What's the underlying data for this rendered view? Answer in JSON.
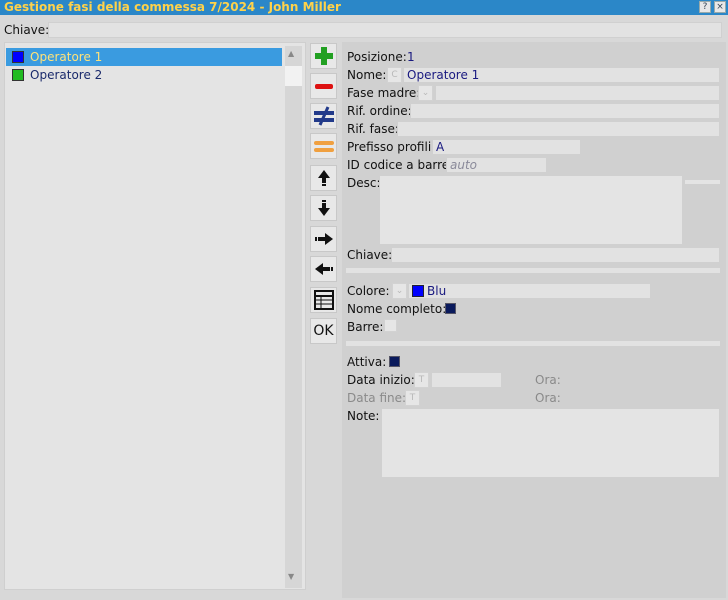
{
  "window": {
    "title": "Gestione fasi della commessa 7/2024 - John Miller",
    "btn_help": "?",
    "btn_close": "×"
  },
  "search": {
    "label": "Chiave:",
    "value": ""
  },
  "operators": [
    {
      "label": "Operatore 1",
      "color": "#0000ff"
    },
    {
      "label": "Operatore 2",
      "color": "#22bb22"
    }
  ],
  "toolbar": {
    "ok_label": "OK"
  },
  "form": {
    "posizione_label": "Posizione:",
    "posizione_value": "1",
    "nome_label": "Nome:",
    "nome_prefix": "C",
    "nome_value": "Operatore 1",
    "fase_madre_label": "Fase madre:",
    "rif_ordine_label": "Rif. ordine:",
    "rif_fase_label": "Rif. fase:",
    "prefisso_label": "Prefisso profili:",
    "prefisso_value": "A",
    "id_codice_label": "ID codice a barre:",
    "id_codice_placeholder": "auto",
    "desc_label": "Desc:",
    "chiave_label": "Chiave:",
    "colore_label": "Colore:",
    "colore_value": "Blu",
    "colore_hex": "#0000ff",
    "nome_completo_label": "Nome completo:",
    "nome_completo_checked": true,
    "barre_label": "Barre:",
    "barre_checked": false,
    "attiva_label": "Attiva:",
    "attiva_checked": true,
    "data_inizio_label": "Data inizio:",
    "data_inizio_btn": "T",
    "ora_label_1": "Ora:",
    "data_fine_label": "Data fine:",
    "data_fine_btn": "T",
    "ora_label_2": "Ora:",
    "note_label": "Note:"
  }
}
